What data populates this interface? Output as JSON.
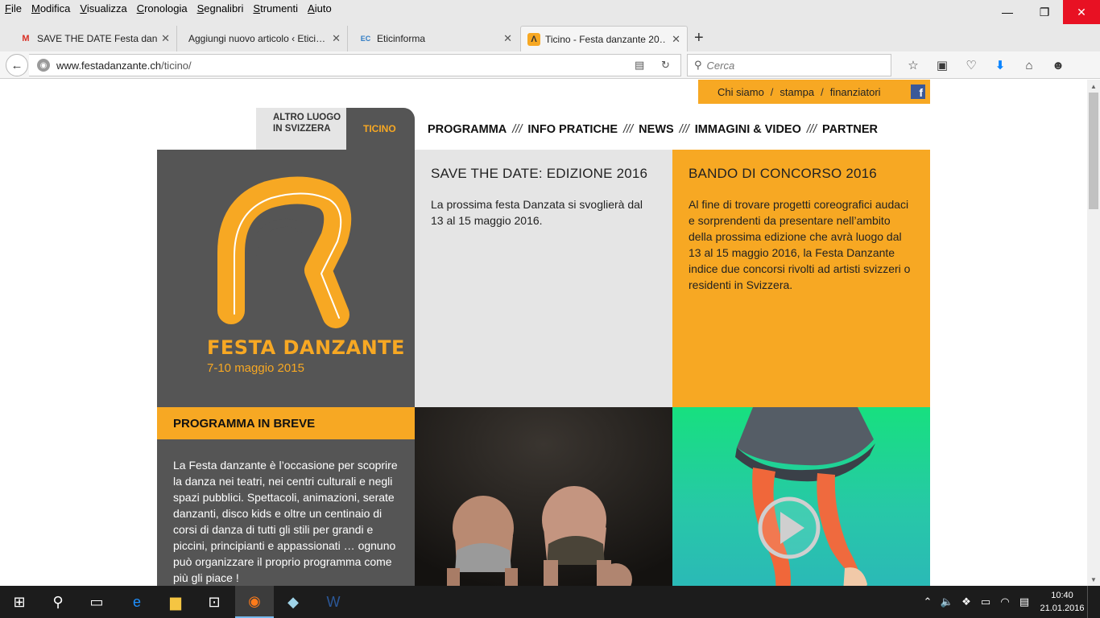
{
  "menubar": {
    "items": [
      "File",
      "Modifica",
      "Visualizza",
      "Cronologia",
      "Segnalibri",
      "Strumenti",
      "Aiuto"
    ]
  },
  "window_controls": {
    "minimize": "—",
    "restore": "❐",
    "close": "✕"
  },
  "tabs": [
    {
      "title": "SAVE THE DATE Festa dan…",
      "favicon": "gmail-icon",
      "fav_glyph": "M",
      "fav_color": "#d93025"
    },
    {
      "title": "Aggiungi nuovo articolo ‹ Etici…",
      "favicon": "blank-icon",
      "fav_glyph": "",
      "fav_color": "#888888"
    },
    {
      "title": "Eticinforma",
      "favicon": "eticinforma-icon",
      "fav_glyph": "EC",
      "fav_color": "#2e7bc4"
    },
    {
      "title": "Ticino - Festa danzante 20…",
      "favicon": "festa-icon",
      "fav_glyph": "Λ",
      "fav_color": "#f7a823"
    }
  ],
  "active_tab": 3,
  "urlbar": {
    "domain": "www.festadanzante.ch",
    "path": "/ticino/"
  },
  "search": {
    "placeholder": "Cerca"
  },
  "topbar": {
    "links": [
      "Chi siamo",
      "stampa",
      "finanziatori"
    ],
    "separator": "/",
    "facebook_glyph": "f"
  },
  "region": {
    "other": "ALTRO LUOGO IN SVIZZERA",
    "current": "TICINO"
  },
  "mainnav": {
    "items": [
      "PROGRAMMA",
      "INFO PRATICHE",
      "NEWS",
      "IMMAGINI & VIDEO",
      "PARTNER"
    ],
    "separator": "///"
  },
  "logo": {
    "text": "FESTA DANZANTE",
    "date": "7-10 maggio 2015"
  },
  "save_the_date": {
    "title": "SAVE THE DATE: EDIZIONE 2016",
    "body": "La prossima festa Danzata si svoglierà dal 13 al 15 maggio 2016."
  },
  "bando": {
    "title": "BANDO DI CONCORSO 2016",
    "body": "Al fine di trovare progetti coreografici audaci e sorprendenti da presentare nell’ambito della prossima edizione che avrà luogo dal 13 al 15 maggio 2016, la Festa Danzante indice due concorsi rivolti ad artisti svizzeri o residenti in Svizzera."
  },
  "programma": {
    "title": "PROGRAMMA IN BREVE",
    "body": "La Festa danzante è l’occasione per scoprire la danza nei teatri, nei centri culturali e negli spazi pubblici. Spettacoli, animazioni, serate danzanti, disco kids e oltre un centinaio di corsi di danza di tutti gli stili per grandi e piccini, principianti e appassionati … ognuno può organizzare il proprio programma come più gli piace !"
  },
  "colors": {
    "accent": "#f7a823",
    "dark": "#555555",
    "light": "#e5e5e5"
  },
  "clock": {
    "time": "10:40",
    "date": "21.01.2016"
  }
}
